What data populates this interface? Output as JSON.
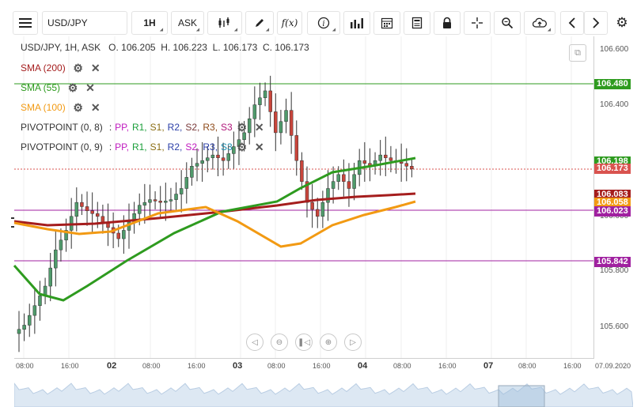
{
  "toolbar": {
    "symbol": "USD/JPY",
    "timeframe": "1H",
    "price_type": "ASK",
    "fx_label": "f(x)"
  },
  "header": {
    "ohlc": "USD/JPY, 1H, ASK   O. 106.205  H. 106.223  L. 106.173  C. 106.173"
  },
  "indicators": [
    {
      "name": "SMA (200)",
      "color": "#a51d1d"
    },
    {
      "name": "SMA (55)",
      "color": "#2e9b1f"
    },
    {
      "name": "SMA (100)",
      "color": "#f29a13"
    }
  ],
  "pivots": [
    {
      "name": "PIVOTPOINT (0, 8)",
      "sep": ":",
      "levels": [
        {
          "t": "PP",
          "c": "#c01abf"
        },
        {
          "t": "R1",
          "c": "#1a9e3a"
        },
        {
          "t": "S1",
          "c": "#8a6d13"
        },
        {
          "t": "R2",
          "c": "#2a3ea7"
        },
        {
          "t": "S2",
          "c": "#7a3a3a"
        },
        {
          "t": "R3",
          "c": "#8e4a1a"
        },
        {
          "t": "S3",
          "c": "#b0167a"
        }
      ]
    },
    {
      "name": "PIVOTPOINT (0, 9)",
      "sep": ":",
      "levels": [
        {
          "t": "PP",
          "c": "#c01abf"
        },
        {
          "t": "R1",
          "c": "#1a9e3a"
        },
        {
          "t": "S1",
          "c": "#8a6d13"
        },
        {
          "t": "R2",
          "c": "#2a3ea7"
        },
        {
          "t": "S2",
          "c": "#c01abf"
        },
        {
          "t": "R3",
          "c": "#2a3ea7"
        },
        {
          "t": "S3",
          "c": "#1a8eb0"
        }
      ]
    }
  ],
  "price_axis": {
    "labels": [
      "106.600",
      "106.400",
      "105.800",
      "105.600",
      "106.000"
    ],
    "tags": [
      {
        "v": "106.480",
        "bg": "#2e9b1f"
      },
      {
        "v": "106.198",
        "bg": "#2e9b1f"
      },
      {
        "v": "106.173",
        "bg": "#d9534f"
      },
      {
        "v": "106.083",
        "bg": "#a51d1d"
      },
      {
        "v": "106.058",
        "bg": "#f29a13"
      },
      {
        "v": "106.023",
        "bg": "#a020a0"
      },
      {
        "v": "105.842",
        "bg": "#a020a0"
      }
    ]
  },
  "time_axis": [
    {
      "t": "08:00",
      "bold": false
    },
    {
      "t": "16:00",
      "bold": false
    },
    {
      "t": "02",
      "bold": true
    },
    {
      "t": "08:00",
      "bold": false
    },
    {
      "t": "16:00",
      "bold": false
    },
    {
      "t": "03",
      "bold": true
    },
    {
      "t": "08:00",
      "bold": false
    },
    {
      "t": "16:00",
      "bold": false
    },
    {
      "t": "04",
      "bold": true
    },
    {
      "t": "08:00",
      "bold": false
    },
    {
      "t": "16:00",
      "bold": false
    },
    {
      "t": "07",
      "bold": true
    },
    {
      "t": "08:00",
      "bold": false
    },
    {
      "t": "16:00",
      "bold": false
    },
    {
      "t": "07.09.2020",
      "bold": false
    }
  ],
  "colors": {
    "bull": "#4f9a6b",
    "bear": "#c8453b",
    "sma200": "#a51d1d",
    "sma55": "#2e9b1f",
    "sma100": "#f29a13",
    "pivot": "#a020a0"
  },
  "chart_data": {
    "type": "candlestick",
    "series": [
      {
        "name": "SMA (200)"
      },
      {
        "name": "SMA (55)"
      },
      {
        "name": "SMA (100)"
      }
    ],
    "horizontal_levels": [
      106.48,
      106.173,
      106.023,
      105.842
    ],
    "close": [
      105.61,
      105.68,
      105.75,
      105.88,
      105.95,
      106.05,
      106.02,
      106.0,
      105.96,
      105.92,
      105.98,
      106.04,
      106.06,
      106.05,
      106.06,
      106.1,
      106.18,
      106.2,
      106.22,
      106.2,
      106.25,
      106.3,
      106.4,
      106.45,
      106.3,
      106.38,
      106.2,
      106.05,
      106.0,
      106.1,
      106.15,
      106.1,
      106.2,
      106.18,
      106.22,
      106.2,
      106.19,
      106.17
    ]
  }
}
